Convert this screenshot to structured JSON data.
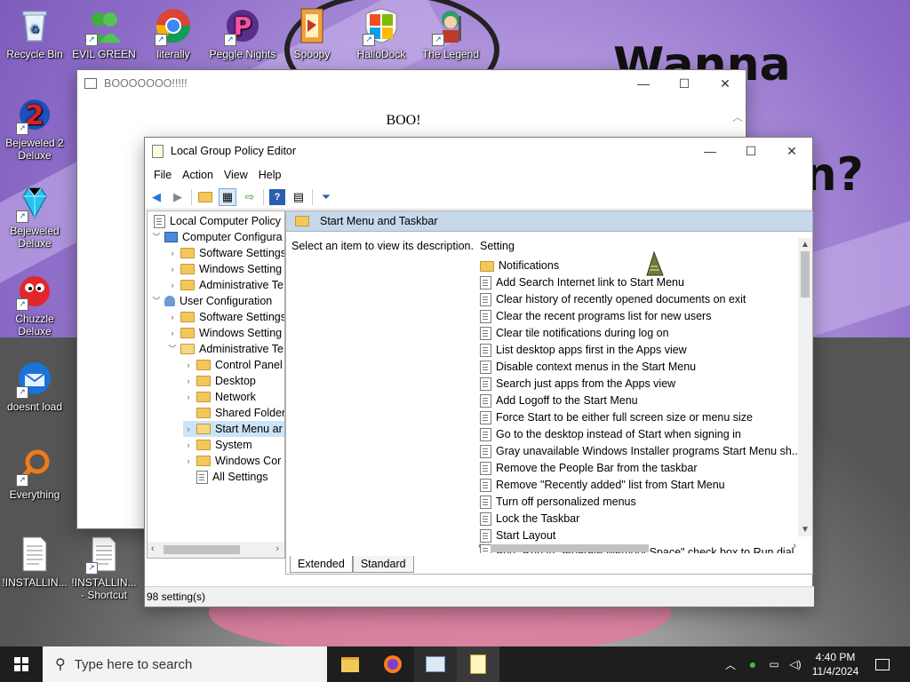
{
  "desktop": {
    "wallpaper_text": [
      "Wanna have",
      "fun?"
    ],
    "icons": [
      {
        "label": "Recycle Bin",
        "icon": "recycle-bin-icon"
      },
      {
        "label": "EVIL GREEN",
        "icon": "evil-green-icon"
      },
      {
        "label": "literally",
        "icon": "chrome-icon"
      },
      {
        "label": "Peggle Nights",
        "icon": "peggle-nights-icon"
      },
      {
        "label": "Spoopy",
        "icon": "spoopy-icon"
      },
      {
        "label": "HalloDock",
        "icon": "windows-logo-icon"
      },
      {
        "label": "The Legend",
        "icon": "legend-icon"
      },
      {
        "label": "Bejeweled 2 Deluxe",
        "icon": "bejeweled-2-icon"
      },
      {
        "label": "Bejeweled Deluxe",
        "icon": "bejeweled-icon"
      },
      {
        "label": "Chuzzle Deluxe",
        "icon": "chuzzle-icon"
      },
      {
        "label": "doesnt load",
        "icon": "thunderbird-icon"
      },
      {
        "label": "Everything",
        "icon": "everything-search-icon"
      },
      {
        "label": "!INSTALLIN...",
        "icon": "text-file-icon"
      },
      {
        "label": "!INSTALLIN... - Shortcut",
        "icon": "text-file-shortcut-icon"
      }
    ]
  },
  "boo_window": {
    "title": "BOOOOOOO!!!!!",
    "content": "BOO!",
    "controls": {
      "minimize": "—",
      "maximize": "☐",
      "close": "✕"
    }
  },
  "gpe": {
    "title": "Local Group Policy Editor",
    "menu": [
      "File",
      "Action",
      "View",
      "Help"
    ],
    "toolbar": [
      "back-icon",
      "forward-icon",
      "up-folder-icon",
      "show-hide-tree-icon",
      "export-list-icon",
      "help-icon",
      "properties-icon",
      "filter-icon"
    ],
    "tree": [
      {
        "label": "Local Computer Policy",
        "level": 0,
        "kind": "policy",
        "chev": ""
      },
      {
        "label": "Computer Configura",
        "level": 1,
        "kind": "computer",
        "chev": "v"
      },
      {
        "label": "Software Settings",
        "level": 2,
        "kind": "folder",
        "chev": ">"
      },
      {
        "label": "Windows Setting",
        "level": 2,
        "kind": "folder",
        "chev": ">"
      },
      {
        "label": "Administrative Te",
        "level": 2,
        "kind": "folder",
        "chev": ">"
      },
      {
        "label": "User Configuration",
        "level": 1,
        "kind": "user",
        "chev": "v"
      },
      {
        "label": "Software Settings",
        "level": 2,
        "kind": "folder",
        "chev": ">"
      },
      {
        "label": "Windows Setting",
        "level": 2,
        "kind": "folder",
        "chev": ">"
      },
      {
        "label": "Administrative Te",
        "level": 2,
        "kind": "folder-open",
        "chev": "v"
      },
      {
        "label": "Control Panel",
        "level": 3,
        "kind": "folder",
        "chev": ">"
      },
      {
        "label": "Desktop",
        "level": 3,
        "kind": "folder",
        "chev": ">"
      },
      {
        "label": "Network",
        "level": 3,
        "kind": "folder",
        "chev": ">"
      },
      {
        "label": "Shared Folder",
        "level": 3,
        "kind": "folder",
        "chev": ""
      },
      {
        "label": "Start Menu ar",
        "level": 3,
        "kind": "folder-open",
        "chev": ">",
        "selected": true
      },
      {
        "label": "System",
        "level": 3,
        "kind": "folder",
        "chev": ">"
      },
      {
        "label": "Windows Cor",
        "level": 3,
        "kind": "folder",
        "chev": ">"
      },
      {
        "label": "All Settings",
        "level": 3,
        "kind": "all",
        "chev": ""
      }
    ],
    "panel_header": "Start Menu and Taskbar",
    "description": "Select an item to view its description.",
    "column_header": "Setting",
    "settings": [
      {
        "label": "Notifications",
        "kind": "folder"
      },
      {
        "label": "Add Search Internet link to Start Menu",
        "kind": "policy"
      },
      {
        "label": "Clear history of recently opened documents on exit",
        "kind": "policy"
      },
      {
        "label": "Clear the recent programs list for new users",
        "kind": "policy"
      },
      {
        "label": "Clear tile notifications during log on",
        "kind": "policy"
      },
      {
        "label": "List desktop apps first in the Apps view",
        "kind": "policy"
      },
      {
        "label": "Disable context menus in the Start Menu",
        "kind": "policy"
      },
      {
        "label": "Search just apps from the Apps view",
        "kind": "policy"
      },
      {
        "label": "Add Logoff to the Start Menu",
        "kind": "policy"
      },
      {
        "label": "Force Start to be either full screen size or menu size",
        "kind": "policy"
      },
      {
        "label": "Go to the desktop instead of Start when signing in",
        "kind": "policy"
      },
      {
        "label": "Gray unavailable Windows Installer programs Start Menu sh...",
        "kind": "policy"
      },
      {
        "label": "Remove the People Bar from the taskbar",
        "kind": "policy"
      },
      {
        "label": "Remove \"Recently added\" list from Start Menu",
        "kind": "policy"
      },
      {
        "label": "Turn off personalized menus",
        "kind": "policy"
      },
      {
        "label": "Lock the Taskbar",
        "kind": "policy"
      },
      {
        "label": "Start Layout",
        "kind": "policy"
      },
      {
        "label": "Add \"Run in Separate Memory Space\" check box to Run dial...",
        "kind": "policy"
      }
    ],
    "tabs": [
      "Extended",
      "Standard"
    ],
    "status": "98 setting(s)",
    "controls": {
      "minimize": "—",
      "maximize": "☐",
      "close": "✕"
    }
  },
  "taskbar": {
    "search_placeholder": "Type here to search",
    "apps": [
      "file-explorer-icon",
      "firefox-icon",
      "group-policy-icon",
      "notepad-icon"
    ],
    "time": "4:40 PM",
    "date": "11/4/2024",
    "colors": {
      "taskbar": "#1e1e1e",
      "accent": "#0078d7"
    }
  }
}
